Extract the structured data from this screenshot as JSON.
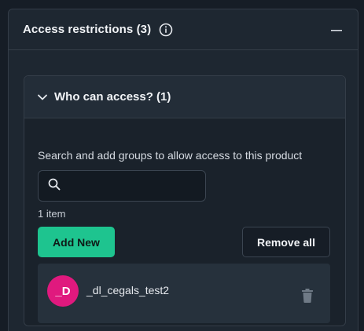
{
  "panel": {
    "title": "Access restrictions (3)",
    "info_icon": "info-icon",
    "collapse_icon": "minus-icon"
  },
  "section": {
    "title": "Who can access? (1)",
    "toggle_icon": "chevron-down-icon",
    "help_text": "Search and add groups to allow access to this product",
    "search": {
      "value": "",
      "placeholder": "",
      "icon": "search-icon"
    },
    "count_text": "1 item",
    "add_button_label": "Add New",
    "remove_all_label": "Remove all",
    "items": [
      {
        "avatar_text": "_D",
        "name": "_dl_cegals_test2",
        "avatar_color": "#e0197e",
        "delete_icon": "trash-icon"
      }
    ]
  },
  "colors": {
    "accent": "#1ec48f",
    "avatar": "#e0197e",
    "background": "#161d26"
  }
}
